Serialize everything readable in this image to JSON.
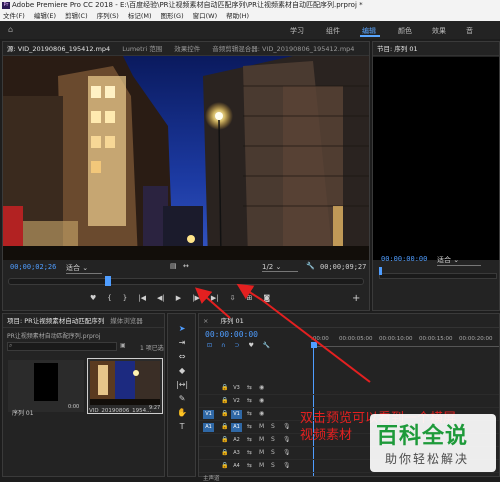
{
  "window": {
    "title": "Adobe Premiere Pro CC 2018 - E:\\百度经验\\PR让视频素材自动匹配序列\\PR让视频素材自动匹配序列.prproj *",
    "app_icon": "Pr"
  },
  "menu": [
    "文件(F)",
    "编辑(E)",
    "剪辑(C)",
    "序列(S)",
    "标记(M)",
    "图形(G)",
    "窗口(W)",
    "帮助(H)"
  ],
  "workspaces": {
    "items": [
      "学习",
      "组件",
      "编辑",
      "颜色",
      "效果",
      "音"
    ],
    "active_index": 2
  },
  "source": {
    "tabs": [
      "源: VID_20190806_195412.mp4",
      "Lumetri 范围",
      "效果控件",
      "音频剪辑混合器: VID_20190806_195412.mp4"
    ],
    "timecode_in": "00;00;02;26",
    "fit": "适合",
    "resolution": "1/2",
    "timecode_out": "00;00;09;27"
  },
  "program": {
    "tab": "节目: 序列 01",
    "timecode": "00:00:00:00",
    "fit": "适合"
  },
  "project": {
    "tabs": [
      "项目: PR让视频素材自动匹配序列",
      "媒体浏览器"
    ],
    "path": "PR让视频素材自动匹配序列.prproj",
    "selection": "1 项已选",
    "items": [
      {
        "name": "序列 01",
        "duration": "0:00"
      },
      {
        "name": "VID_20190806_1954...",
        "duration": "9:27"
      }
    ]
  },
  "timeline": {
    "tab": "序列 01",
    "timecode": "00:00:00:00",
    "ruler": [
      ":00:00",
      "00:00:05:00",
      "00:00:10:00",
      "00:00:15:00",
      "00:00:20:00"
    ],
    "tracks": [
      {
        "label": "V3",
        "src": "",
        "kind": "video"
      },
      {
        "label": "V2",
        "src": "",
        "kind": "video"
      },
      {
        "label": "V1",
        "src": "V1",
        "kind": "video"
      },
      {
        "label": "A1",
        "src": "A1",
        "kind": "audio"
      },
      {
        "label": "A2",
        "src": "",
        "kind": "audio"
      },
      {
        "label": "A3",
        "src": "",
        "kind": "audio"
      },
      {
        "label": "A4",
        "src": "",
        "kind": "audio"
      }
    ],
    "master": "主声道"
  },
  "annotation": {
    "line1": "双击预览可以看到一个横屏",
    "line2": "视频素材"
  },
  "watermark": {
    "line1": "百科全说",
    "line2": "助你轻松解决"
  },
  "colors": {
    "accent_blue": "#4f9dff",
    "annotation_red": "#e32020",
    "watermark_green": "#1e9a3a"
  }
}
